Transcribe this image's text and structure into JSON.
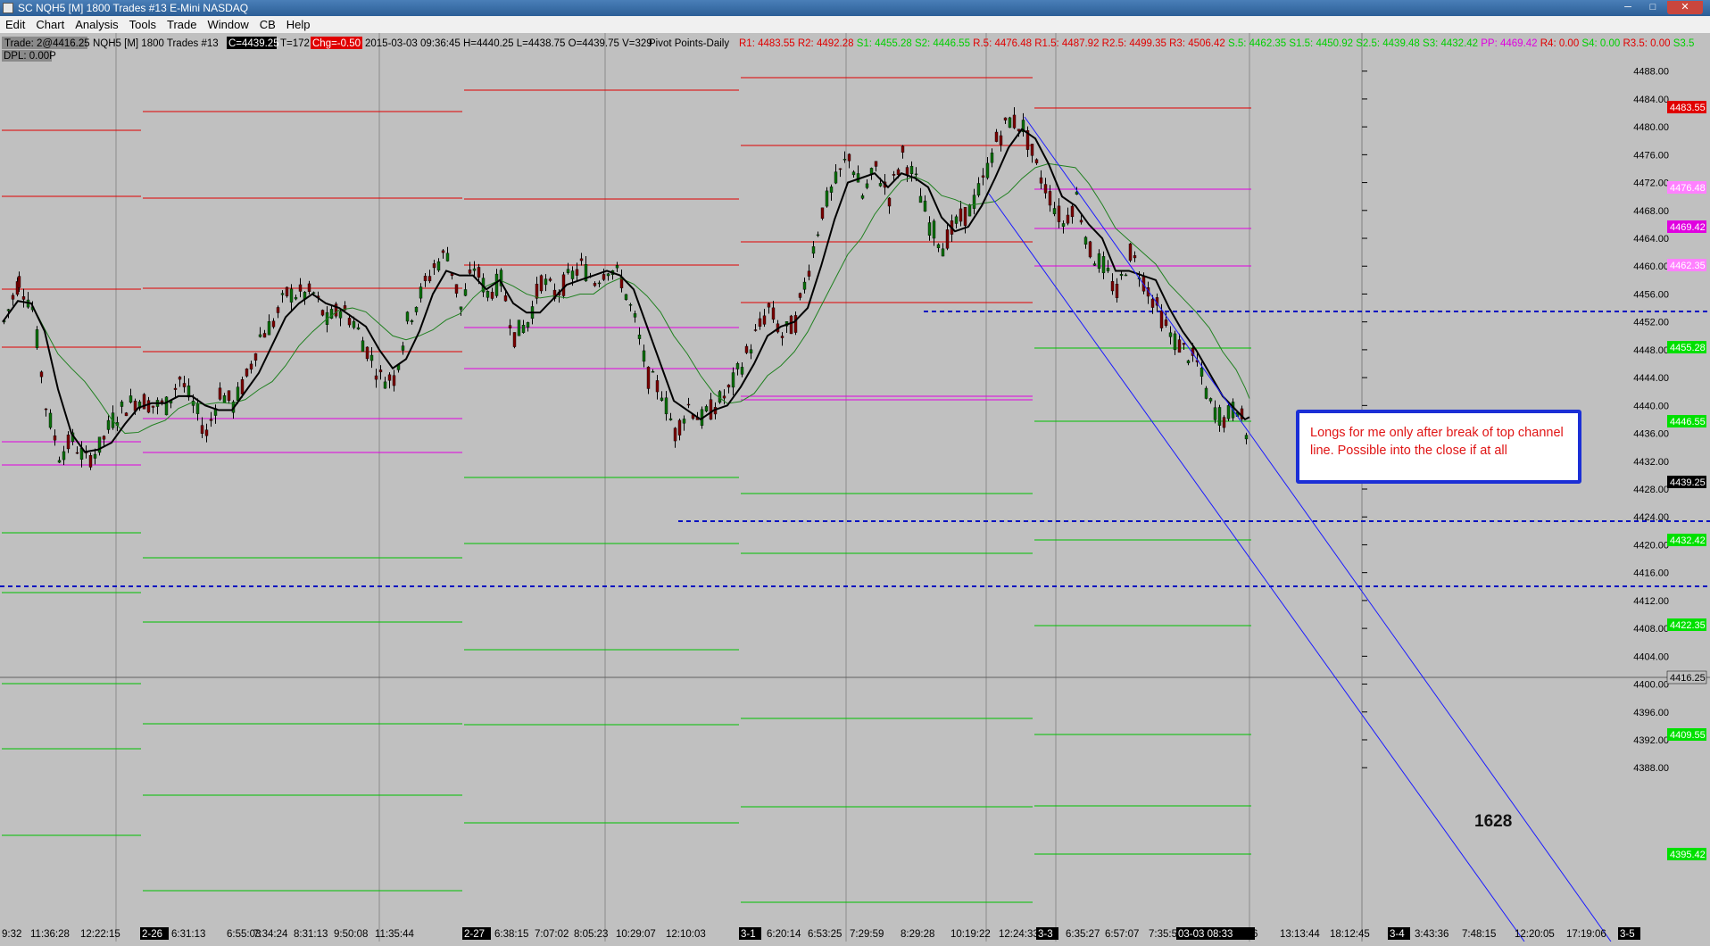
{
  "window": {
    "title": "SC NQH5 [M]  1800 Trades  #13  E-Mini NASDAQ",
    "btn_min": "─",
    "btn_max": "□",
    "btn_close": "✕"
  },
  "menu": [
    "Edit",
    "Chart",
    "Analysis",
    "Tools",
    "Trade",
    "Window",
    "CB",
    "Help"
  ],
  "header": {
    "trade": "Trade: 2@4416.25",
    "symbol": "NQH5 [M]  1800 Trades  #13",
    "close": "C=4439.25",
    "ticks": "T=172",
    "change": "Chg=-0.50",
    "bar": "2015-03-03 09:36:45 H=4440.25 L=4438.75 O=4439.75 V=329",
    "study": "Pivot Points-Daily",
    "dpl": "DPL: 0.00P",
    "pivots_red": "R1: 4483.55  R2: 4492.28  ",
    "pivots_green": "S1: 4455.28  S2: 4446.55  ",
    "pivots_red2": "R.5: 4476.48  R1.5: 4487.92  R2.5: 4499.35  R3: 4506.42  ",
    "pivots_green2": "S.5: 4462.35  S1.5: 4450.92  S2.5: 4439.48  S3: 4432.42  ",
    "pivots_pp": "PP: 4469.42  ",
    "pivots_red3": "R4: 0.00  ",
    "pivots_green3": "S4: 0.00  ",
    "pivots_red4": "R3.5: 0.00  ",
    "pivots_green4": "S3.5"
  },
  "price_axis": [
    "4488.00",
    "4484.00",
    "4480.00",
    "4476.00",
    "4472.00",
    "4468.00",
    "4464.00",
    "4460.00",
    "4456.00",
    "4452.00",
    "4448.00",
    "4444.00",
    "4440.00",
    "4436.00",
    "4432.00",
    "4428.00",
    "4424.00",
    "4420.00",
    "4416.00",
    "4412.00",
    "4408.00",
    "4404.00",
    "4400.00",
    "4396.00",
    "4392.00",
    "4388.00"
  ],
  "price_tags": {
    "r1": "4483.55",
    "r5": "4476.48",
    "pp": "4469.42",
    "s5": "4462.35",
    "s1": "4455.28",
    "s2": "4446.55",
    "last": "4439.25",
    "s3": "4432.42",
    "s4a": "4422.35",
    "trade": "4416.25",
    "s4b": "4409.55",
    "s5b": "4395.42"
  },
  "time_axis": [
    "9:32",
    "11:36:28",
    "12:22:15",
    "2-26",
    "6:31:13",
    "6:55:03",
    "7:34:24",
    "8:31:13",
    "9:50:08",
    "11:35:44",
    "2-27",
    "6:38:15",
    "7:07:02",
    "8:05:23",
    "10:29:07",
    "12:10:03",
    "3-1",
    "6:20:14",
    "6:53:25",
    "7:29:59",
    "8:29:28",
    "10:19:22",
    "12:24:33",
    "3-3",
    "6:35:27",
    "6:57:07",
    "7:35:55",
    "03-03  08:33",
    "5:06",
    "13:13:44",
    "18:12:45",
    "3-4",
    "3:43:36",
    "7:48:15",
    "12:20:05",
    "17:19:06",
    "3-5"
  ],
  "annotation": "Longs for me only after break of top channel line.  Possible into the close if at all",
  "label_1628": "1628",
  "colors": {
    "background": "#c0c0c0",
    "resistance": "#e00000",
    "support": "#00c000",
    "pivot": "#e000e0",
    "channel": "#1a1aff",
    "dashed": "#0010c0",
    "ma_fast": "#000000",
    "ma_slow": "#208020",
    "up_candle": "#0a6e0a",
    "down_candle": "#7a0000"
  }
}
